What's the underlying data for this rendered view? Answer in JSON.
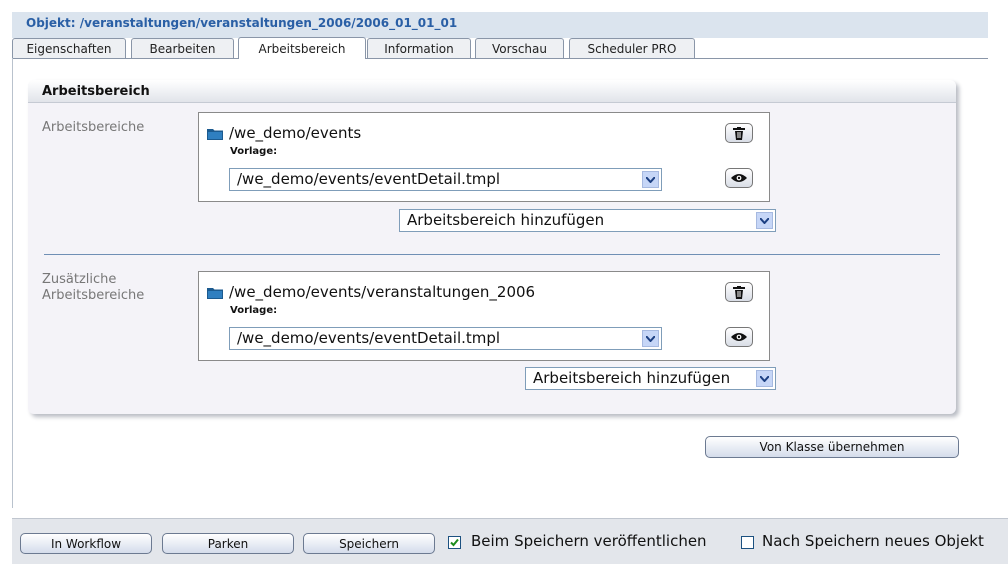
{
  "header": {
    "title": "Objekt: /veranstaltungen/veranstaltungen_2006/2006_01_01_01"
  },
  "tabs": [
    {
      "label": "Eigenschaften"
    },
    {
      "label": "Bearbeiten"
    },
    {
      "label": "Arbeitsbereich"
    },
    {
      "label": "Information"
    },
    {
      "label": "Vorschau"
    },
    {
      "label": "Scheduler PRO"
    }
  ],
  "active_tab": "Arbeitsbereich",
  "panel": {
    "title": "Arbeitsbereich",
    "workspace": {
      "label": "Arbeitsbereiche",
      "path": "/we_demo/events",
      "template_label": "Vorlage:",
      "template_value": "/we_demo/events/eventDetail.tmpl",
      "add_label": "Arbeitsbereich hinzufügen"
    },
    "extra": {
      "label_line1": "Zusätzliche",
      "label_line2": "Arbeitsbereiche",
      "path": "/we_demo/events/veranstaltungen_2006",
      "template_label": "Vorlage:",
      "template_value": "/we_demo/events/eventDetail.tmpl",
      "add_label": "Arbeitsbereich hinzufügen"
    }
  },
  "class_button": "Von Klasse übernehmen",
  "footer": {
    "workflow": "In Workflow",
    "park": "Parken",
    "save": "Speichern",
    "publish_label": "Beim Speichern veröffentlichen",
    "publish_checked": true,
    "new_label": "Nach Speichern neues Objekt",
    "new_checked": false
  },
  "colors": {
    "title": "#2a5fa5",
    "header_bg": "#dbe4ee",
    "panel_bg": "#f4f3f8",
    "footer_bg": "#e3e6eb",
    "separator": "#6f8fb5"
  },
  "icons": [
    "folder-icon",
    "trash-icon",
    "eye-icon",
    "chevron-down-icon",
    "checkmark-icon"
  ]
}
